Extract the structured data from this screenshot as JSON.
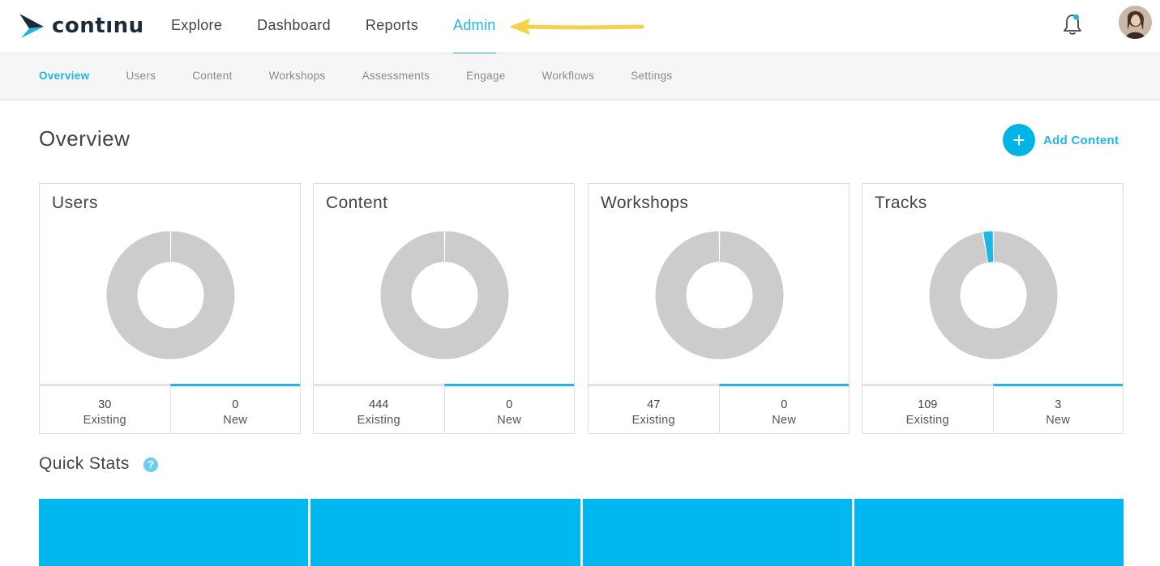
{
  "brand": {
    "name": "contınu"
  },
  "main_nav": [
    {
      "label": "Explore",
      "active": false
    },
    {
      "label": "Dashboard",
      "active": false
    },
    {
      "label": "Reports",
      "active": false
    },
    {
      "label": "Admin",
      "active": true
    }
  ],
  "header_icons": {
    "notifications": "bell-icon",
    "avatar": "user-avatar"
  },
  "sub_nav": [
    {
      "label": "Overview",
      "active": true
    },
    {
      "label": "Users",
      "active": false
    },
    {
      "label": "Content",
      "active": false
    },
    {
      "label": "Workshops",
      "active": false
    },
    {
      "label": "Assessments",
      "active": false
    },
    {
      "label": "Engage",
      "active": false
    },
    {
      "label": "Workflows",
      "active": false
    },
    {
      "label": "Settings",
      "active": false
    }
  ],
  "page": {
    "title": "Overview",
    "add_content_label": "Add Content",
    "add_content_icon": "+"
  },
  "cards": [
    {
      "title": "Users",
      "existing": "30",
      "existing_label": "Existing",
      "new": "0",
      "new_label": "New"
    },
    {
      "title": "Content",
      "existing": "444",
      "existing_label": "Existing",
      "new": "0",
      "new_label": "New"
    },
    {
      "title": "Workshops",
      "existing": "47",
      "existing_label": "Existing",
      "new": "0",
      "new_label": "New"
    },
    {
      "title": "Tracks",
      "existing": "109",
      "existing_label": "Existing",
      "new": "3",
      "new_label": "New"
    }
  ],
  "quick_stats": {
    "title": "Quick Stats",
    "help_icon": "?"
  },
  "colors": {
    "accent": "#1fb6e6",
    "donut_existing": "#cccccc",
    "donut_new": "#1fb6e6",
    "tile": "#00b8ef"
  }
}
